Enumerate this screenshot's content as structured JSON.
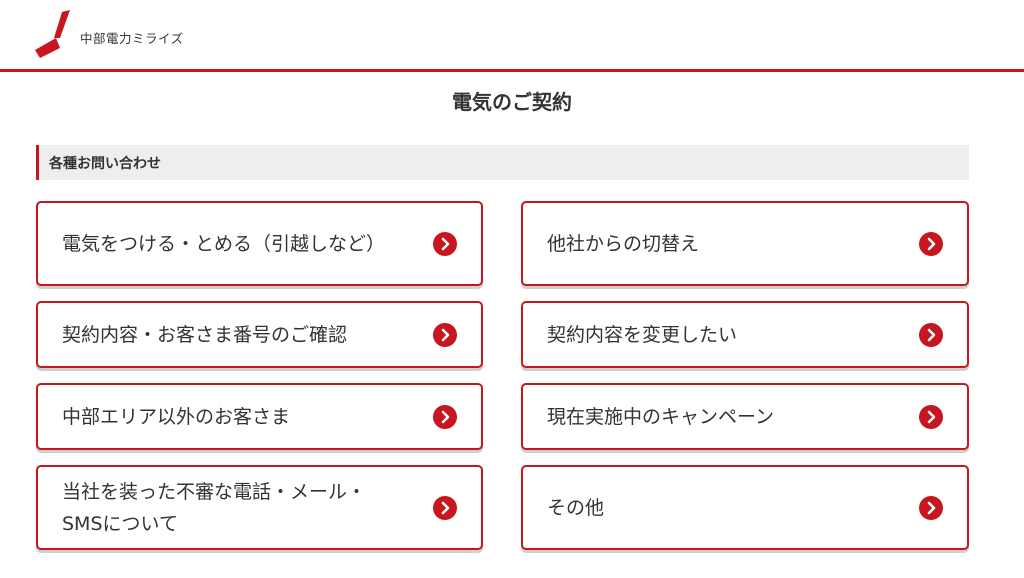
{
  "header": {
    "brand_name": "中部電力ミライズ"
  },
  "page": {
    "title": "電気のご契約"
  },
  "section": {
    "label": "各種お問い合わせ"
  },
  "colors": {
    "accent": "#c8161e",
    "section_bg": "#eeeeee",
    "text": "#333333"
  },
  "cards": [
    {
      "label": "電気をつける・とめる（引越しなど）",
      "icon": "chevron-right-circle-icon"
    },
    {
      "label": "他社からの切替え",
      "icon": "chevron-right-circle-icon"
    },
    {
      "label": "契約内容・お客さま番号のご確認",
      "icon": "chevron-right-circle-icon"
    },
    {
      "label": "契約内容を変更したい",
      "icon": "chevron-right-circle-icon"
    },
    {
      "label": "中部エリア以外のお客さま",
      "icon": "chevron-right-circle-icon"
    },
    {
      "label": "現在実施中のキャンペーン",
      "icon": "chevron-right-circle-icon"
    },
    {
      "label": "当社を装った不審な電話・メール・SMSについて",
      "icon": "chevron-right-circle-icon"
    },
    {
      "label": "その他",
      "icon": "chevron-right-circle-icon"
    }
  ]
}
